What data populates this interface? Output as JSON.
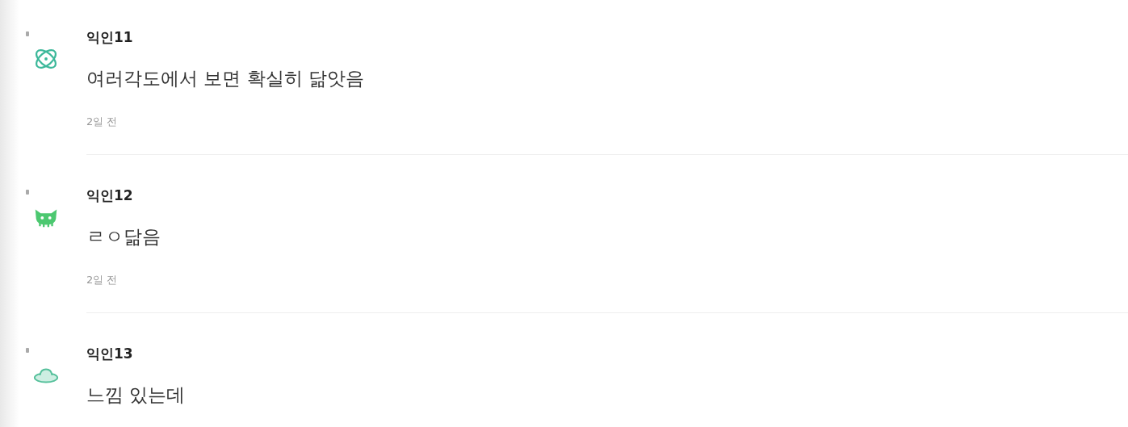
{
  "comments": [
    {
      "kind": "atom",
      "author": "익인11",
      "body": "여러각도에서 보면 확실히 닮앗음",
      "time": "2일 전"
    },
    {
      "kind": "monster",
      "author": "익인12",
      "body": "ㄹㅇ닮음",
      "time": "2일 전"
    },
    {
      "kind": "ufo",
      "author": "익인13",
      "body": "느낌 있는데"
    }
  ]
}
